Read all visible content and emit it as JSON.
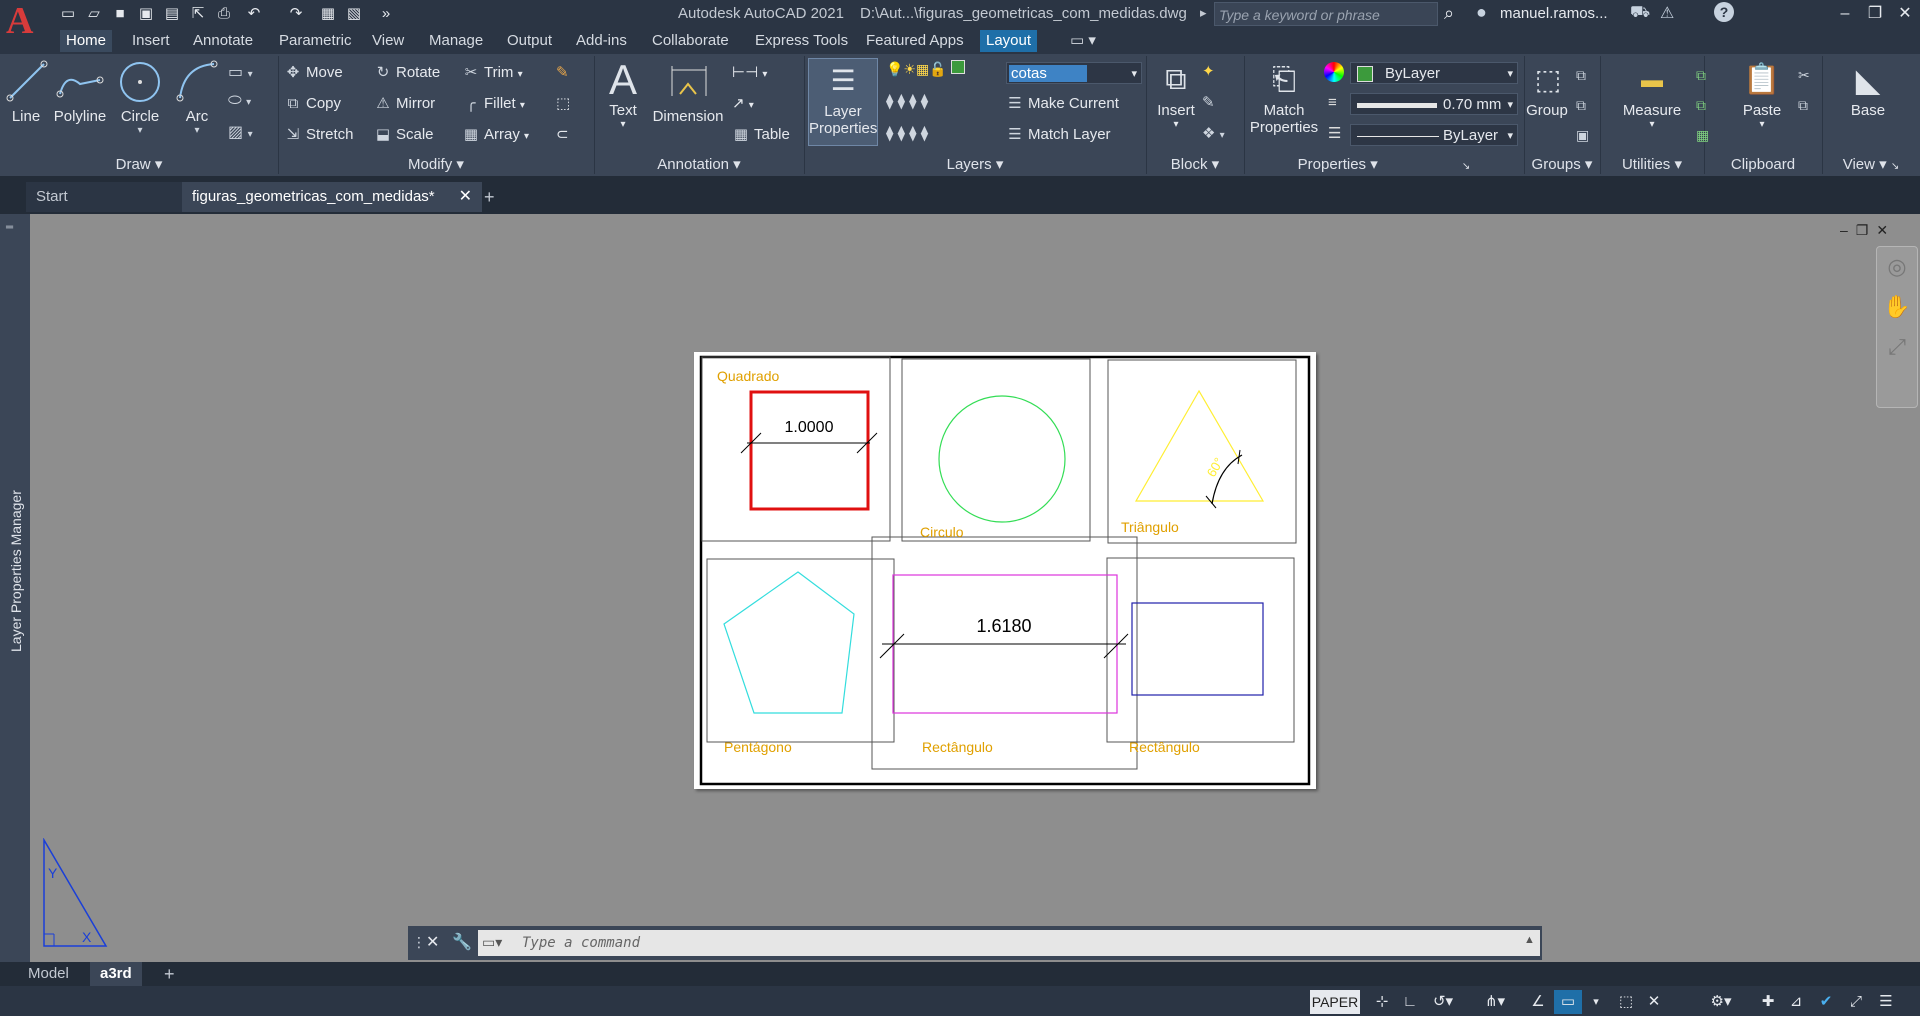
{
  "app": {
    "title": "Autodesk AutoCAD 2021",
    "file_path": "D:\\Aut...\\figuras_geometricas_com_medidas.dwg",
    "search_placeholder": "Type a keyword or phrase",
    "user": "manuel.ramos...",
    "help": "?"
  },
  "menu_tabs": [
    "Home",
    "Insert",
    "Annotate",
    "Parametric",
    "View",
    "Manage",
    "Output",
    "Add-ins",
    "Collaborate",
    "Express Tools",
    "Featured Apps",
    "Layout"
  ],
  "ribbon": {
    "draw": {
      "title": "Draw",
      "line": "Line",
      "polyline": "Polyline",
      "circle": "Circle",
      "arc": "Arc"
    },
    "modify": {
      "title": "Modify",
      "move": "Move",
      "rotate": "Rotate",
      "trim": "Trim",
      "copy": "Copy",
      "mirror": "Mirror",
      "fillet": "Fillet",
      "stretch": "Stretch",
      "scale": "Scale",
      "array": "Array"
    },
    "annotation": {
      "title": "Annotation",
      "text": "Text",
      "dimension": "Dimension",
      "table": "Table"
    },
    "layers": {
      "title": "Layers",
      "layer_properties_1": "Layer",
      "layer_properties_2": "Properties",
      "current_layer": "cotas",
      "make_current": "Make Current",
      "match_layer": "Match Layer"
    },
    "block": {
      "title": "Block",
      "insert": "Insert"
    },
    "properties": {
      "title": "Properties",
      "match_1": "Match",
      "match_2": "Properties",
      "color": "ByLayer",
      "lineweight": "0.70 mm",
      "linetype": "ByLayer"
    },
    "groups": {
      "title": "Groups",
      "group": "Group"
    },
    "utilities": {
      "title": "Utilities",
      "measure": "Measure"
    },
    "clipboard": {
      "title": "Clipboard",
      "paste": "Paste"
    },
    "view": {
      "title": "View",
      "base": "Base"
    }
  },
  "doc_tabs": {
    "start": "Start",
    "file": "figuras_geometricas_com_medidas*",
    "add": "+"
  },
  "sidebar_label": "Layer Properties Manager",
  "drawing": {
    "labels": {
      "quadrado": "Quadrado",
      "circulo": "Circulo",
      "triangulo": "Triângulo",
      "pentagono": "Pentágono",
      "rectangulo_mid": "Rectângulo",
      "rectangulo_right": "Rectângulo"
    },
    "dim_square": "1.0000",
    "dim_rect": "1.6180",
    "angle": "60°"
  },
  "colors": {
    "square": "#e01010",
    "circle": "#33dd55",
    "triangle": "#ffee33",
    "pentagon": "#33dddd",
    "rect_magenta": "#dd33dd",
    "rect_blue": "#2020aa",
    "label": "#e0a000"
  },
  "command_placeholder": "Type a command",
  "layout_tabs": {
    "model": "Model",
    "a3rd": "a3rd",
    "add": "+"
  },
  "status": {
    "paper": "PAPER"
  }
}
